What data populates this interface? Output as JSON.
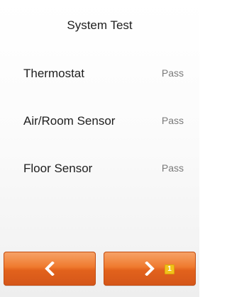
{
  "header": {
    "title": "System Test"
  },
  "tests": [
    {
      "label": "Thermostat",
      "status": "Pass"
    },
    {
      "label": "Air/Room Sensor",
      "status": "Pass"
    },
    {
      "label": "Floor Sensor",
      "status": "Pass"
    }
  ],
  "footer": {
    "back_icon": "chevron-left-icon",
    "next_icon": "chevron-right-icon",
    "next_badge": "1"
  },
  "colors": {
    "button_orange": "#ef7a2e",
    "badge_yellow": "#f2c21a",
    "status_gray": "#7a7a7a"
  }
}
